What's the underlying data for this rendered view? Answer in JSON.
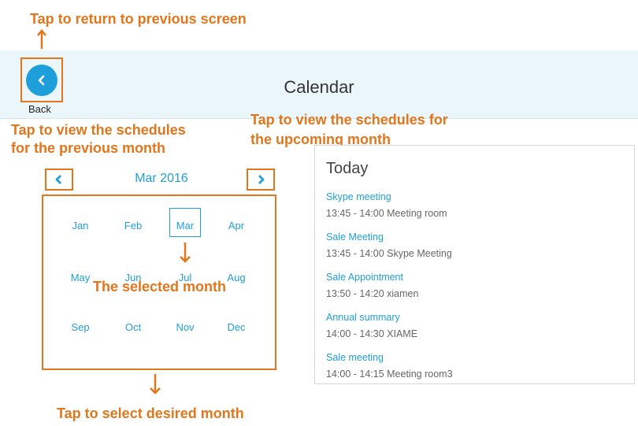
{
  "header": {
    "title": "Calendar",
    "back_label": "Back"
  },
  "annotations": {
    "back": "Tap to return to previous screen",
    "prev_month_line1": "Tap to view the schedules",
    "prev_month_line2": "for the previous month",
    "next_month_line1": "Tap to view the schedules for",
    "next_month_line2": "the upcoming month",
    "selected": "The selected month",
    "select_desired": "Tap to select desired month"
  },
  "calendar": {
    "current": "Mar 2016",
    "selected_month": "Mar",
    "months": [
      "Jan",
      "Feb",
      "Mar",
      "Apr",
      "May",
      "Jun",
      "Jul",
      "Aug",
      "Sep",
      "Oct",
      "Nov",
      "Dec"
    ]
  },
  "today": {
    "title": "Today",
    "events": [
      {
        "name": "Skype meeting",
        "time": "13:45 - 14:00 Meeting room"
      },
      {
        "name": "Sale Meeting",
        "time": "13:45 - 14:00 Skype Meeting"
      },
      {
        "name": "Sale Appointment",
        "time": "13:50 - 14:20 xiamen"
      },
      {
        "name": "Annual summary",
        "time": "14:00 - 14:30 XIAME"
      },
      {
        "name": "Sale meeting",
        "time": "14:00 - 14:15 Meeting room3"
      }
    ]
  },
  "colors": {
    "accent": "#1f9fd9",
    "annotation": "#e2761c",
    "header_bg": "#ebf6fb"
  }
}
